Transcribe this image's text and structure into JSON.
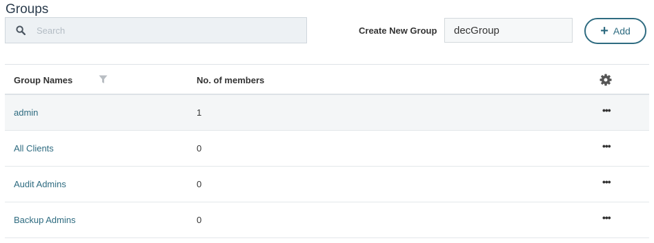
{
  "page": {
    "title": "Groups"
  },
  "search": {
    "placeholder": "Search",
    "icon": "search-icon"
  },
  "create_group": {
    "label": "Create New Group",
    "value": "decGroup"
  },
  "add_button": {
    "label": "Add",
    "icon": "plus-icon"
  },
  "table": {
    "headers": {
      "name": "Group Names",
      "members": "No. of members"
    },
    "rows": [
      {
        "name": "admin",
        "members": "1",
        "more": "•••"
      },
      {
        "name": "All Clients",
        "members": "0",
        "more": "•••"
      },
      {
        "name": "Audit Admins",
        "members": "0",
        "more": "•••"
      },
      {
        "name": "Backup Admins",
        "members": "0",
        "more": "•••"
      }
    ]
  },
  "colors": {
    "accent": "#2e6b80",
    "title": "#2a3b4c",
    "search_bg": "#edf1f4"
  }
}
